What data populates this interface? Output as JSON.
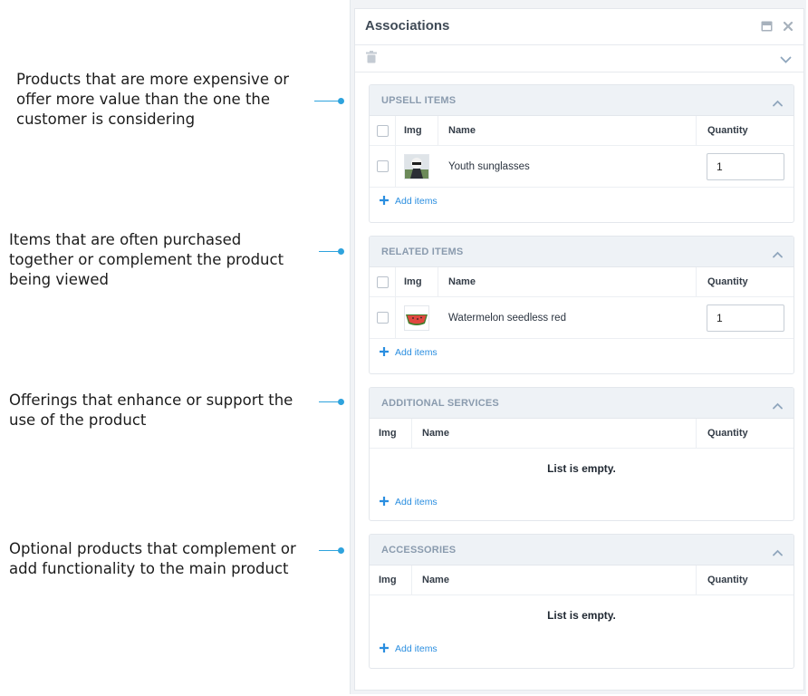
{
  "annotations": [
    "Products that are more expensive or offer more value than the one the customer is considering",
    "Items that are often purchased together or complement the product being viewed",
    "Offerings that enhance or support the use of the product",
    "Optional products that complement or add functionality to the main product"
  ],
  "panel": {
    "title": "Associations",
    "header_icons": [
      "minimize-icon",
      "close-icon"
    ],
    "toolbar_icons": [
      "trash-icon",
      "chevron-down-icon"
    ]
  },
  "sections": [
    {
      "title": "UPSELL ITEMS",
      "columns": {
        "img": "Img",
        "name": "Name",
        "quantity": "Quantity"
      },
      "items": [
        {
          "name": "Youth sunglasses",
          "quantity": "1",
          "thumb": "sunglasses-thumbnail"
        }
      ],
      "add_label": "Add items"
    },
    {
      "title": "RELATED ITEMS",
      "columns": {
        "img": "Img",
        "name": "Name",
        "quantity": "Quantity"
      },
      "items": [
        {
          "name": "Watermelon seedless red",
          "quantity": "1",
          "thumb": "watermelon-thumbnail"
        }
      ],
      "add_label": "Add items"
    },
    {
      "title": "ADDITIONAL SERVICES",
      "columns": {
        "img": "Img",
        "name": "Name",
        "quantity": "Quantity"
      },
      "empty_text": "List is empty.",
      "add_label": "Add items"
    },
    {
      "title": "ACCESSORIES",
      "columns": {
        "img": "Img",
        "name": "Name",
        "quantity": "Quantity"
      },
      "empty_text": "List is empty.",
      "add_label": "Add items"
    }
  ],
  "colors": {
    "accent": "#2ea3dd",
    "link": "#2a8ee0",
    "section_header_bg": "#eef2f6"
  }
}
